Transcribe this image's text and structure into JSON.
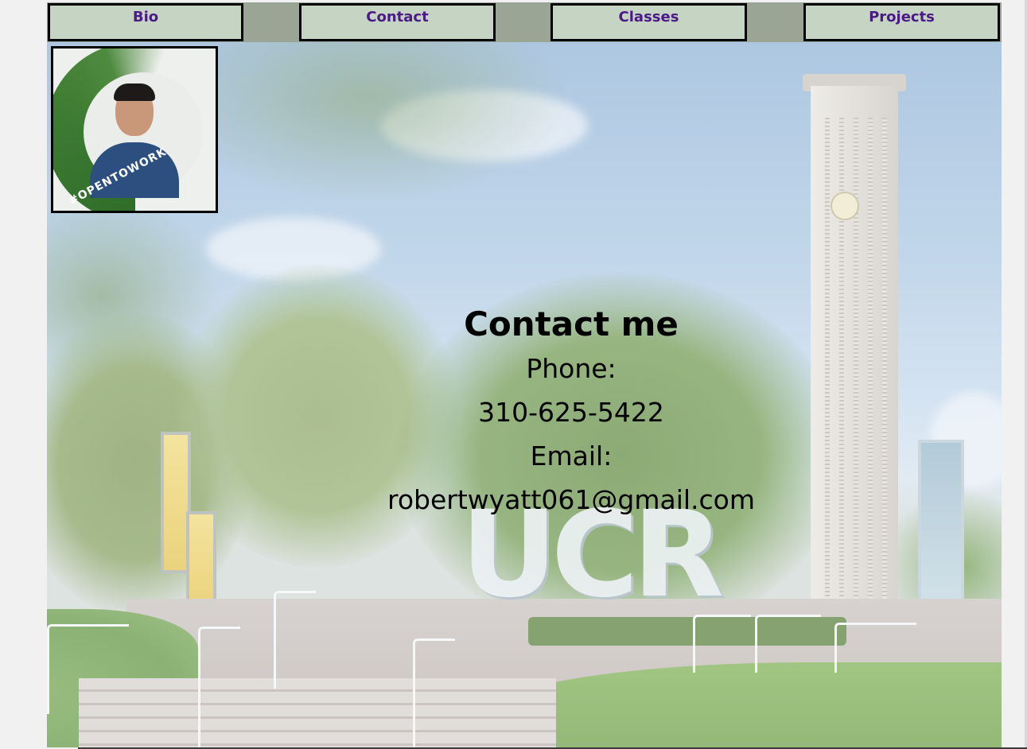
{
  "nav": {
    "items": [
      {
        "label": "Bio"
      },
      {
        "label": "Contact"
      },
      {
        "label": "Classes"
      },
      {
        "label": "Projects"
      }
    ]
  },
  "profile": {
    "tag": "#OPENTOWORK"
  },
  "hero": {
    "sign_text": "UCR"
  },
  "contact": {
    "heading": "Contact me",
    "phone_label": "Phone:",
    "phone_value": "310-625-5422",
    "email_label": "Email:",
    "email_value": "robertwyatt061@gmail.com"
  },
  "colors": {
    "nav_bg": "#9aa596",
    "nav_button_bg": "#c6d4c3",
    "nav_text": "#4b1a86",
    "profile_ring": "#3e7d33"
  }
}
